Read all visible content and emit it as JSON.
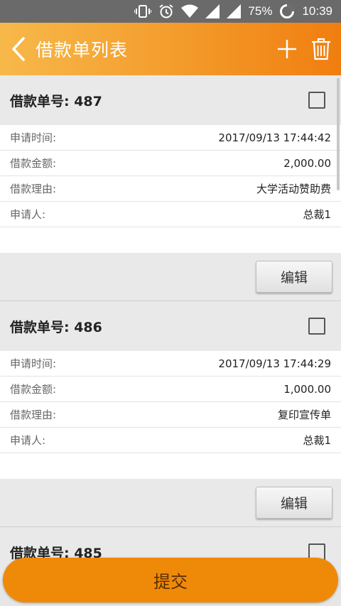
{
  "status_bar": {
    "battery": "75%",
    "time": "10:39"
  },
  "header": {
    "title": "借款单列表",
    "back_icon": "chevron-left-icon",
    "add_icon": "plus-icon",
    "delete_icon": "trash-icon"
  },
  "labels": {
    "applied_time": "申请时间:",
    "amount": "借款金额:",
    "reason": "借款理由:",
    "applicant": "申请人:"
  },
  "cards": [
    {
      "title": "借款单号: 487",
      "applied_time": "2017/09/13 17:44:42",
      "amount": "2,000.00",
      "reason": "大学活动赞助费",
      "applicant": "总裁1",
      "edit_label": "编辑"
    },
    {
      "title": "借款单号: 486",
      "applied_time": "2017/09/13 17:44:29",
      "amount": "1,000.00",
      "reason": "复印宣传单",
      "applicant": "总裁1",
      "edit_label": "编辑"
    },
    {
      "title": "借款单号: 485"
    }
  ],
  "submit_label": "提交",
  "colors": {
    "accent": "#f39a2a",
    "submit": "#ef8a08"
  }
}
